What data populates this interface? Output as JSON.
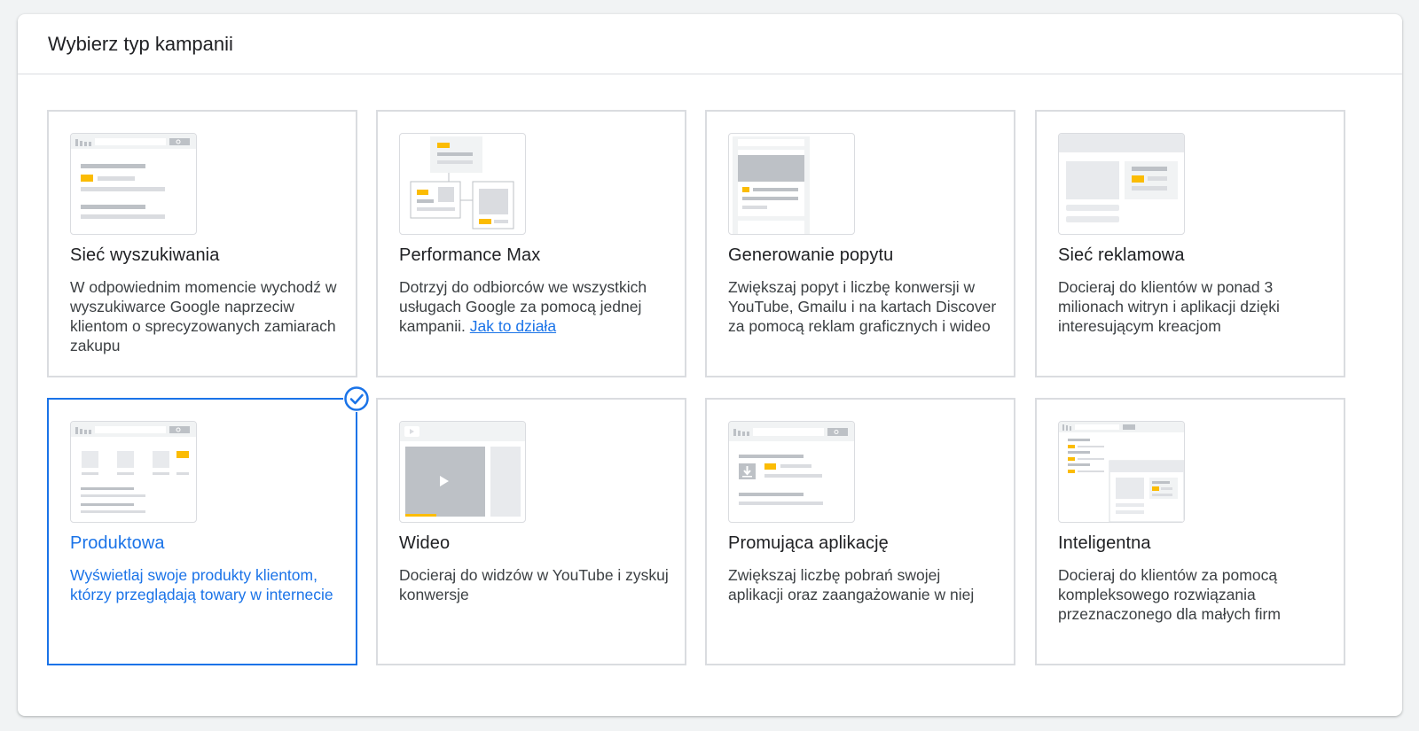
{
  "dialog": {
    "title": "Wybierz typ kampanii"
  },
  "campaign_types": [
    {
      "title": "Sieć wyszukiwania",
      "description": "W odpowiednim momencie wychodź w wyszukiwarce Google naprzeciw klientom o sprecyzowanych zamiarach zakupu",
      "selected": false
    },
    {
      "title": "Performance Max",
      "description": "Dotrzyj do odbiorców we wszystkich usługach Google za pomocą jednej kampanii.",
      "link": "Jak to działa",
      "selected": false
    },
    {
      "title": "Generowanie popytu",
      "description": "Zwiększaj popyt i liczbę konwersji w YouTube, Gmailu i na kartach Discover za pomocą reklam graficznych i wideo",
      "selected": false
    },
    {
      "title": "Sieć reklamowa",
      "description": "Docieraj do klientów w ponad 3 milionach witryn i aplikacji dzięki interesującym kreacjom",
      "selected": false
    },
    {
      "title": "Produktowa",
      "description": "Wyświetlaj swoje produkty klientom, którzy przeglądają towary w internecie",
      "selected": true
    },
    {
      "title": "Wideo",
      "description": "Docieraj do widzów w YouTube i zyskuj konwersje",
      "selected": false
    },
    {
      "title": "Promująca aplikację",
      "description": "Zwiększaj liczbę pobrań swojej aplikacji oraz zaangażowanie w niej",
      "selected": false
    },
    {
      "title": "Inteligentna",
      "description": "Docieraj do klientów za pomocą kompleksowego rozwiązania przeznaczonego dla małych firm",
      "selected": false
    }
  ],
  "colors": {
    "accent": "#1a73e8",
    "highlight": "#fbbc04",
    "placeholder": "#dadce0",
    "border": "#dadce0"
  },
  "icons": [
    "search-thumbnail-icon",
    "performance-max-thumbnail-icon",
    "demand-gen-thumbnail-icon",
    "display-thumbnail-icon",
    "shopping-thumbnail-icon",
    "video-thumbnail-icon",
    "app-thumbnail-icon",
    "smart-thumbnail-icon",
    "check-circle-icon"
  ]
}
